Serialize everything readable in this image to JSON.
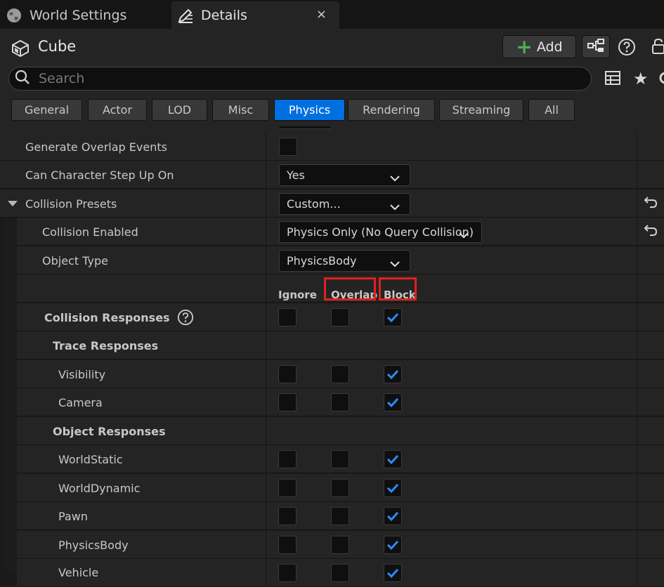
{
  "tabs": [
    {
      "label": "World Settings",
      "icon": "globe-icon"
    },
    {
      "label": "Details",
      "icon": "edit-details-icon",
      "close": "×"
    }
  ],
  "actor": {
    "name": "Cube",
    "icon": "static-mesh-icon"
  },
  "toolbar": {
    "add_label": "Add"
  },
  "search": {
    "placeholder": "Search"
  },
  "categories": [
    "General",
    "Actor",
    "LOD",
    "Misc",
    "Physics",
    "Rendering",
    "Streaming",
    "All"
  ],
  "selected_category": "Physics",
  "properties": {
    "generate_overlap_events": {
      "label": "Generate Overlap Events",
      "checked": false
    },
    "can_character_step_up_on": {
      "label": "Can Character Step Up On",
      "value": "Yes"
    },
    "collision_presets": {
      "label": "Collision Presets",
      "value": "Custom..."
    },
    "collision_enabled": {
      "label": "Collision Enabled",
      "value": "Physics Only (No Query Collision)"
    },
    "object_type": {
      "label": "Object Type",
      "value": "PhysicsBody"
    }
  },
  "response_columns": {
    "ignore": "Ignore",
    "overlap": "Overlap",
    "block": "Block"
  },
  "collision_responses": {
    "label": "Collision Responses",
    "ignore": false,
    "overlap": false,
    "block": true
  },
  "trace_responses": {
    "label": "Trace Responses",
    "items": [
      {
        "label": "Visibility",
        "ignore": false,
        "overlap": false,
        "block": true
      },
      {
        "label": "Camera",
        "ignore": false,
        "overlap": false,
        "block": true
      }
    ]
  },
  "object_responses": {
    "label": "Object Responses",
    "items": [
      {
        "label": "WorldStatic",
        "ignore": false,
        "overlap": false,
        "block": true
      },
      {
        "label": "WorldDynamic",
        "ignore": false,
        "overlap": false,
        "block": true
      },
      {
        "label": "Pawn",
        "ignore": false,
        "overlap": false,
        "block": true
      },
      {
        "label": "PhysicsBody",
        "ignore": false,
        "overlap": false,
        "block": true
      },
      {
        "label": "Vehicle",
        "ignore": false,
        "overlap": false,
        "block": true
      }
    ]
  },
  "colors": {
    "accent": "#0070e0",
    "check": "#2b8cff",
    "add_plus": "#4caf50",
    "highlight": "#e02020"
  }
}
